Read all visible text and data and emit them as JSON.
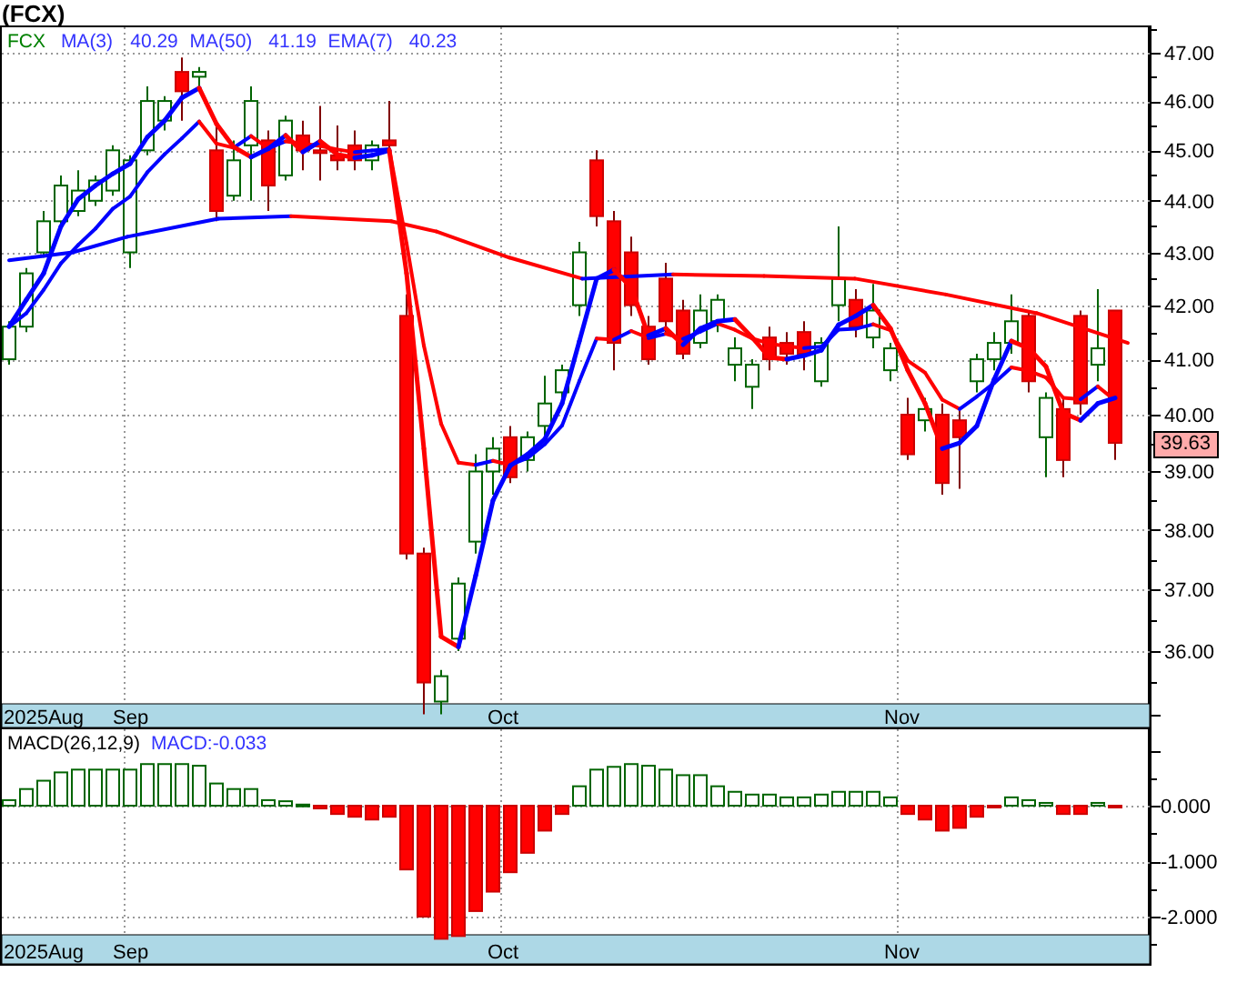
{
  "title": "(FCX)",
  "price_panel": {
    "legend": [
      {
        "text": "FCX",
        "color": "#008000"
      },
      {
        "text": "MA(3)",
        "color": "#3333ff"
      },
      {
        "text": "40.29",
        "color": "#3333ff"
      },
      {
        "text": "MA(50)",
        "color": "#3333ff"
      },
      {
        "text": "41.19",
        "color": "#3333ff"
      },
      {
        "text": "EMA(7)",
        "color": "#3333ff"
      },
      {
        "text": "40.23",
        "color": "#3333ff"
      }
    ],
    "y_axis_labels": [
      "47.00",
      "46.00",
      "45.00",
      "44.00",
      "43.00",
      "42.00",
      "41.00",
      "40.00",
      "39.00",
      "38.00",
      "37.00",
      "36.00"
    ],
    "last_price": "39.63",
    "date_labels": [
      "2025Aug",
      "Sep",
      "Oct",
      "Nov"
    ]
  },
  "macd_panel": {
    "legend": [
      {
        "text": "MACD(26,12,9)",
        "color": "#000000"
      },
      {
        "text": "MACD:-0.033",
        "color": "#3333ff"
      }
    ],
    "y_axis_labels": [
      "0.000",
      "-1.000",
      "-2.000"
    ],
    "date_labels": [
      "2025Aug",
      "Sep",
      "Oct",
      "Nov"
    ]
  }
}
